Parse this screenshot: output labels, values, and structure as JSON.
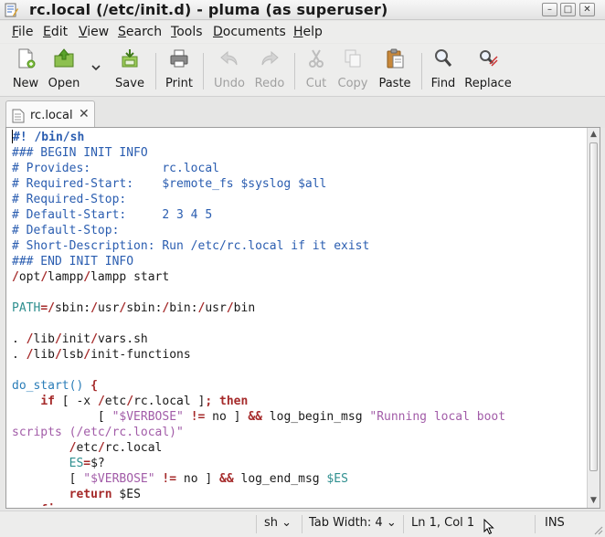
{
  "window": {
    "title": "rc.local (/etc/init.d) - pluma (as superuser)",
    "minimize_glyph": "–",
    "maximize_glyph": "□",
    "close_glyph": "✕"
  },
  "menu": [
    "File",
    "Edit",
    "View",
    "Search",
    "Tools",
    "Documents",
    "Help"
  ],
  "toolbar": {
    "new_label": "New",
    "open_label": "Open",
    "save_label": "Save",
    "print_label": "Print",
    "undo_label": "Undo",
    "redo_label": "Redo",
    "cut_label": "Cut",
    "copy_label": "Copy",
    "paste_label": "Paste",
    "find_label": "Find",
    "replace_label": "Replace"
  },
  "tab": {
    "label": "rc.local",
    "close_glyph": "✕"
  },
  "code_lines": [
    [
      [
        "#! /bin/sh",
        "c-comment",
        "bold"
      ]
    ],
    [
      [
        "### BEGIN INIT INFO",
        "c-comment"
      ]
    ],
    [
      [
        "# Provides:          rc.local",
        "c-comment"
      ]
    ],
    [
      [
        "# Required-Start:    $remote_fs $syslog $all",
        "c-comment"
      ]
    ],
    [
      [
        "# Required-Stop:",
        "c-comment"
      ]
    ],
    [
      [
        "# Default-Start:     2 3 4 5",
        "c-comment"
      ]
    ],
    [
      [
        "# Default-Stop:",
        "c-comment"
      ]
    ],
    [
      [
        "# Short-Description: Run /etc/rc.local if it exist",
        "c-comment"
      ]
    ],
    [
      [
        "### END INIT INFO",
        "c-comment"
      ]
    ],
    [
      [
        "/",
        "c-path"
      ],
      [
        "opt",
        "c-text"
      ],
      [
        "/",
        "c-path"
      ],
      [
        "lampp",
        "c-text"
      ],
      [
        "/",
        "c-path"
      ],
      [
        "lampp start",
        "c-text"
      ]
    ],
    [
      [
        "",
        "c-text"
      ]
    ],
    [
      [
        "PATH",
        "c-var"
      ],
      [
        "=",
        "c-op"
      ],
      [
        "/",
        "c-path"
      ],
      [
        "sbin",
        "c-text"
      ],
      [
        ":",
        "c-text"
      ],
      [
        "/",
        "c-path"
      ],
      [
        "usr",
        "c-text"
      ],
      [
        "/",
        "c-path"
      ],
      [
        "sbin",
        "c-text"
      ],
      [
        ":",
        "c-text"
      ],
      [
        "/",
        "c-path"
      ],
      [
        "bin",
        "c-text"
      ],
      [
        ":",
        "c-text"
      ],
      [
        "/",
        "c-path"
      ],
      [
        "usr",
        "c-text"
      ],
      [
        "/",
        "c-path"
      ],
      [
        "bin",
        "c-text"
      ]
    ],
    [
      [
        "",
        "c-text"
      ]
    ],
    [
      [
        ". ",
        "c-text"
      ],
      [
        "/",
        "c-path"
      ],
      [
        "lib",
        "c-text"
      ],
      [
        "/",
        "c-path"
      ],
      [
        "init",
        "c-text"
      ],
      [
        "/",
        "c-path"
      ],
      [
        "vars.sh",
        "c-text"
      ]
    ],
    [
      [
        ". ",
        "c-text"
      ],
      [
        "/",
        "c-path"
      ],
      [
        "lib",
        "c-text"
      ],
      [
        "/",
        "c-path"
      ],
      [
        "lsb",
        "c-text"
      ],
      [
        "/",
        "c-path"
      ],
      [
        "init-functions",
        "c-text"
      ]
    ],
    [
      [
        "",
        "c-text"
      ]
    ],
    [
      [
        "do_start",
        "c-func"
      ],
      [
        "() ",
        "c-func"
      ],
      [
        "{",
        "c-op"
      ]
    ],
    [
      [
        "    ",
        "c-text"
      ],
      [
        "if",
        "c-kw"
      ],
      [
        " [ -x ",
        "c-text"
      ],
      [
        "/",
        "c-path"
      ],
      [
        "etc",
        "c-text"
      ],
      [
        "/",
        "c-path"
      ],
      [
        "rc.local ]",
        "c-text"
      ],
      [
        "; ",
        "c-op"
      ],
      [
        "then",
        "c-kw"
      ]
    ],
    [
      [
        "            [ ",
        "c-text"
      ],
      [
        "\"$VERBOSE\"",
        "c-string"
      ],
      [
        " ",
        "c-text"
      ],
      [
        "!=",
        "c-op"
      ],
      [
        " no ] ",
        "c-text"
      ],
      [
        "&&",
        "c-op"
      ],
      [
        " log_begin_msg ",
        "c-text"
      ],
      [
        "\"Running local boot",
        "c-string"
      ]
    ],
    [
      [
        "scripts (/etc/rc.local)\"",
        "c-string"
      ]
    ],
    [
      [
        "        ",
        "c-text"
      ],
      [
        "/",
        "c-path"
      ],
      [
        "etc",
        "c-text"
      ],
      [
        "/",
        "c-path"
      ],
      [
        "rc.local",
        "c-text"
      ]
    ],
    [
      [
        "        ",
        "c-text"
      ],
      [
        "ES",
        "c-var"
      ],
      [
        "=",
        "c-op"
      ],
      [
        "$?",
        "c-text"
      ]
    ],
    [
      [
        "        [ ",
        "c-text"
      ],
      [
        "\"$VERBOSE\"",
        "c-string"
      ],
      [
        " ",
        "c-text"
      ],
      [
        "!=",
        "c-op"
      ],
      [
        " no ] ",
        "c-text"
      ],
      [
        "&&",
        "c-op"
      ],
      [
        " log_end_msg ",
        "c-text"
      ],
      [
        "$ES",
        "c-var"
      ]
    ],
    [
      [
        "        ",
        "c-text"
      ],
      [
        "return",
        "c-kw"
      ],
      [
        " $ES",
        "c-text"
      ]
    ],
    [
      [
        "    ",
        "c-text"
      ],
      [
        "fi",
        "c-kw"
      ]
    ]
  ],
  "statusbar": {
    "language": "sh",
    "tab_width": "Tab Width:  4",
    "position": "Ln 1, Col 1",
    "mode": "INS",
    "dropdown_glyph": "⌄"
  }
}
